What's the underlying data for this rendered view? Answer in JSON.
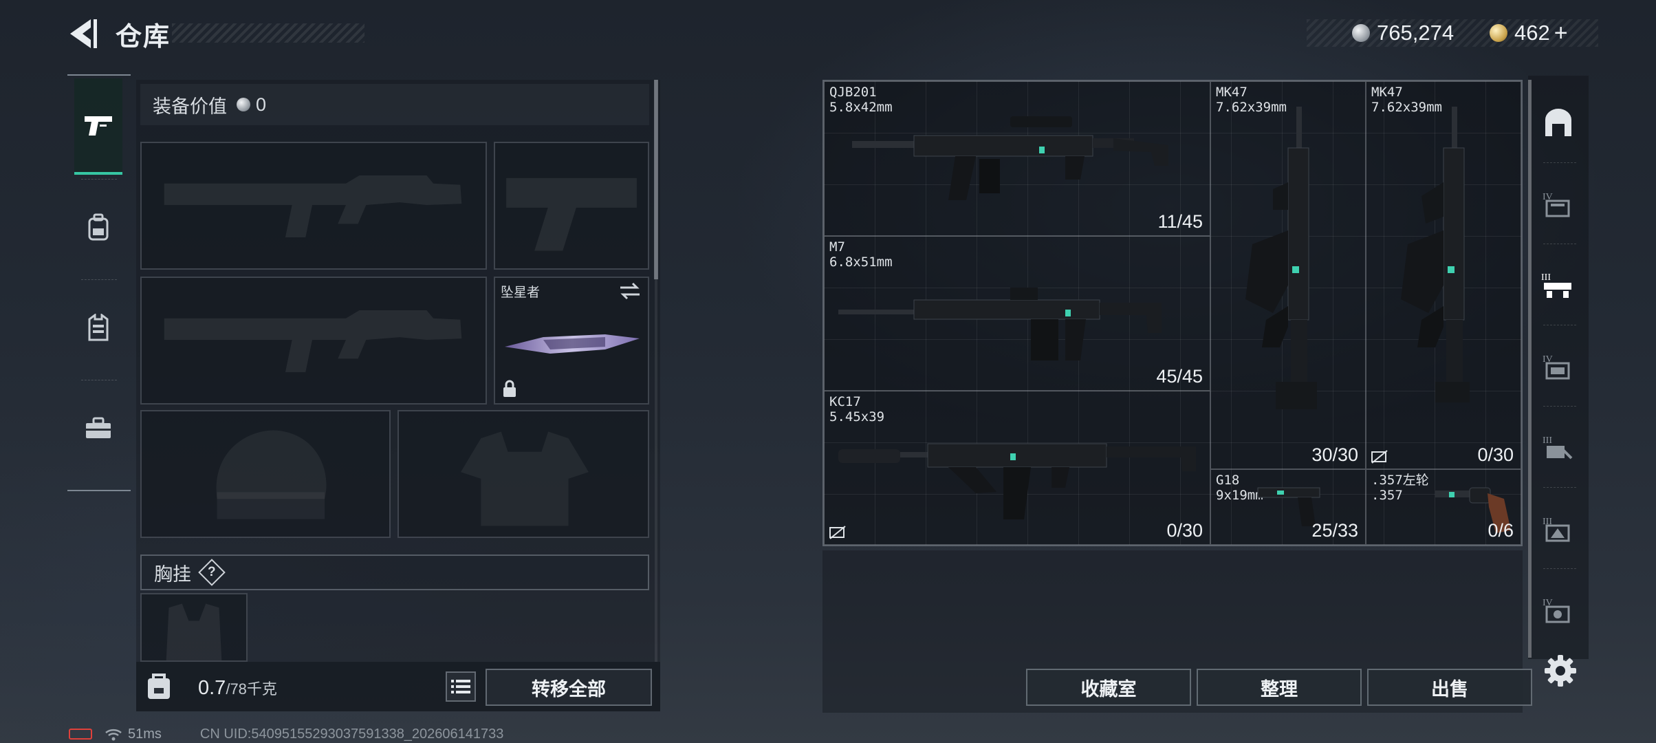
{
  "header": {
    "title": "仓库",
    "currency_silver": "765,274",
    "currency_gold": "462",
    "currency_gold_plus": "+"
  },
  "left_nav": {
    "tabs": [
      {
        "icon": "pistol-icon",
        "active": true
      },
      {
        "icon": "backpack-icon",
        "active": false
      },
      {
        "icon": "vest-icon",
        "active": false
      },
      {
        "icon": "toolbox-icon",
        "active": false
      }
    ]
  },
  "loadout": {
    "equip_value_label": "装备价值",
    "equip_value": "0",
    "melee_name": "坠星者",
    "chest_rig_label": "胸挂",
    "chest_rig_help": "?",
    "weight_current": "0.7",
    "weight_max": "/78千克",
    "transfer_all_label": "转移全部"
  },
  "storage": {
    "items": [
      {
        "name": "QJB201",
        "caliber": "5.8x42mm",
        "ammo": "11/45"
      },
      {
        "name": "M7",
        "caliber": "6.8x51mm",
        "ammo": "45/45"
      },
      {
        "name": "KC17",
        "caliber": "5.45x39",
        "ammo": "0/30"
      },
      {
        "name": "MK47",
        "caliber": "7.62x39mm",
        "ammo": "30/30"
      },
      {
        "name": "MK47",
        "caliber": "7.62x39mm",
        "ammo": "0/30"
      },
      {
        "name": "G18",
        "caliber": "9x19mm",
        "ammo": "25/33"
      },
      {
        "name": ".357左轮",
        "caliber": ".357",
        "ammo": "0/6"
      }
    ],
    "collection_button": "收藏室",
    "sort_button": "整理",
    "sell_button": "出售"
  },
  "right_rail": {
    "tabs": [
      "locker-icon",
      "storage-iv-icon",
      "storage-iii-icon",
      "storage-iv-icon",
      "storage-iii-icon",
      "storage-iii-icon",
      "storage-iv-icon"
    ]
  },
  "status": {
    "ping": "51ms",
    "uid": "CN UID:5409515529303759133​8_202606141733"
  },
  "colors": {
    "accent": "#36c6a3",
    "battery": "#e0413b"
  }
}
